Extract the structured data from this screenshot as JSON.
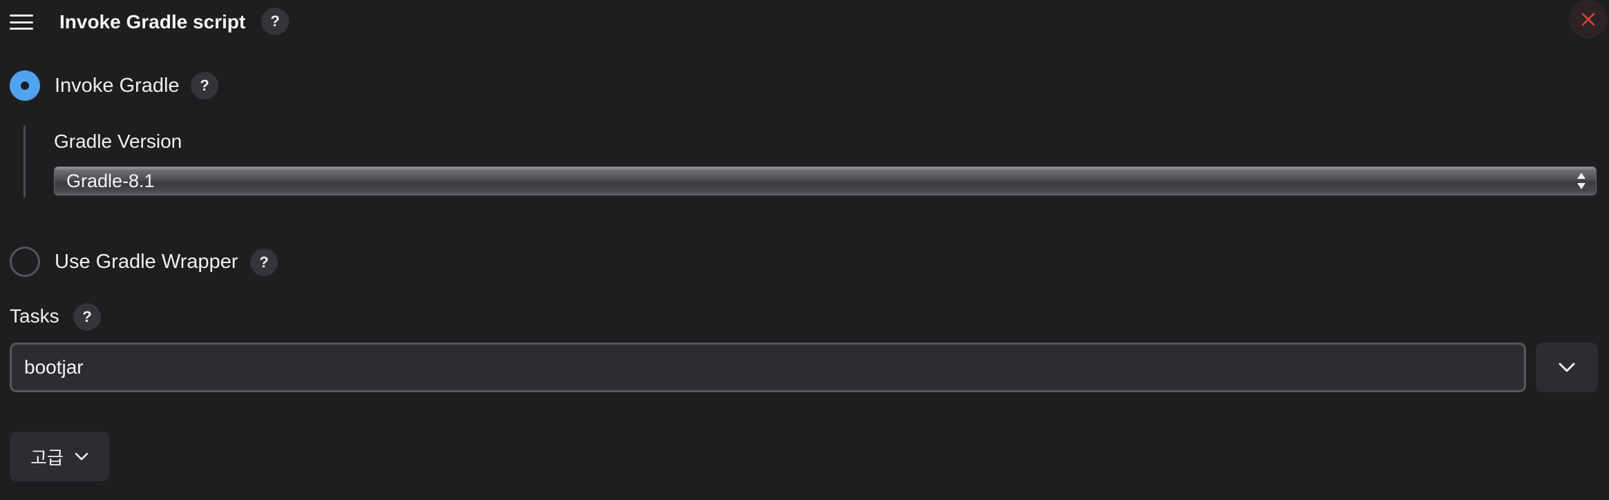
{
  "header": {
    "title": "Invoke Gradle script",
    "help_label": "?",
    "drag_icon": "hamburger-icon",
    "close_icon": "close-icon",
    "close_color": "#e0453a"
  },
  "invoke_gradle": {
    "label": "Invoke Gradle",
    "help_label": "?",
    "selected": true,
    "accent": "#4fa3f0"
  },
  "gradle_version": {
    "label": "Gradle Version",
    "value": "Gradle-8.1"
  },
  "gradle_wrapper": {
    "label": "Use Gradle Wrapper",
    "help_label": "?",
    "selected": false
  },
  "tasks": {
    "label": "Tasks",
    "help_label": "?",
    "value": "bootjar",
    "dropdown_icon": "chevron-down-icon"
  },
  "advanced": {
    "label": "고급",
    "icon": "chevron-down-icon"
  }
}
